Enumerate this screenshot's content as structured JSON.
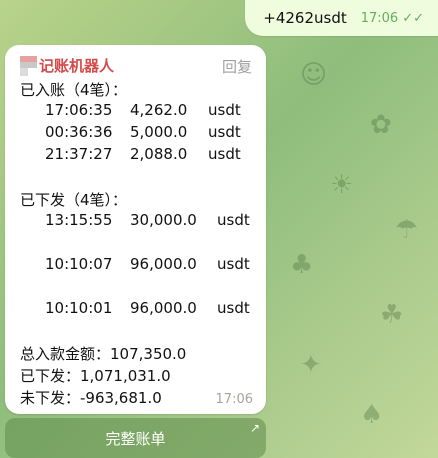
{
  "outgoing": {
    "text": "+4262usdt",
    "time": "17:06",
    "status_icon": "double-check-icon"
  },
  "incoming": {
    "sender_name": "记账机器人",
    "reply_label": "回复",
    "received_header": "已入账（4笔）：",
    "received": [
      {
        "time": "17:06:35",
        "amount": "4,262.0",
        "unit": "usdt"
      },
      {
        "time": "00:36:36",
        "amount": "5,000.0",
        "unit": "usdt"
      },
      {
        "time": "21:37:27",
        "amount": "2,088.0",
        "unit": "usdt"
      }
    ],
    "issued_header": "已下发（4笔）：",
    "issued": [
      {
        "time": "13:15:55",
        "amount": "30,000.0",
        "unit": "usdt"
      },
      {
        "time": "10:10:07",
        "amount": "96,000.0",
        "unit": "usdt"
      },
      {
        "time": "10:10:01",
        "amount": "96,000.0",
        "unit": "usdt"
      }
    ],
    "total_in": "总入款金额：107,350.0",
    "total_issued": "已下发：1,071,031.0",
    "not_issued": "未下发：-963,681.0",
    "time": "17:06"
  },
  "keyboard": {
    "button_label": "完整账单",
    "button_icon": "arrow-up-right-icon"
  }
}
